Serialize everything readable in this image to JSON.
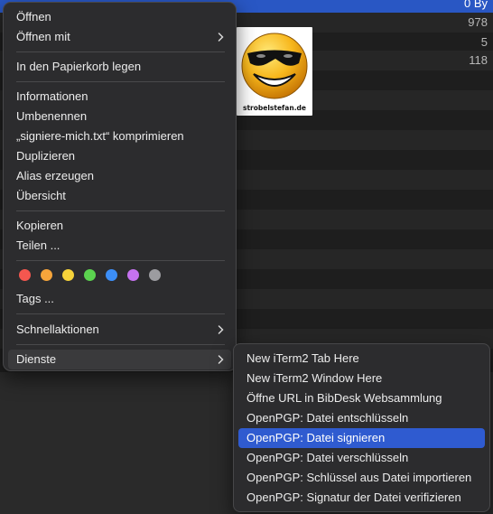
{
  "background": {
    "sizes": [
      "0 By",
      "978",
      "5",
      "118"
    ]
  },
  "preview": {
    "watermark": "strobelstefan.de"
  },
  "context_menu": {
    "items": [
      {
        "label": "Öffnen"
      },
      {
        "label": "Öffnen mit",
        "submenu": true
      },
      {
        "label": "In den Papierkorb legen"
      },
      {
        "label": "Informationen"
      },
      {
        "label": "Umbenennen"
      },
      {
        "label": "„signiere-mich.txt“ komprimieren"
      },
      {
        "label": "Duplizieren"
      },
      {
        "label": "Alias erzeugen"
      },
      {
        "label": "Übersicht"
      },
      {
        "label": "Kopieren"
      },
      {
        "label": "Teilen ..."
      },
      {
        "label": "Tags ..."
      },
      {
        "label": "Schnellaktionen",
        "submenu": true
      },
      {
        "label": "Dienste",
        "submenu": true,
        "highlighted": true
      }
    ],
    "tag_colors": [
      "#f4574f",
      "#f7a53b",
      "#f5d23a",
      "#5bd34f",
      "#3c8ef7",
      "#c672f0",
      "#9c9ca0"
    ]
  },
  "services_submenu": {
    "items": [
      {
        "label": "New iTerm2 Tab Here"
      },
      {
        "label": "New iTerm2 Window Here"
      },
      {
        "label": "Öffne URL in BibDesk Websammlung"
      },
      {
        "label": "OpenPGP: Datei entschlüsseln"
      },
      {
        "label": "OpenPGP: Datei signieren",
        "active": true
      },
      {
        "label": "OpenPGP: Datei verschlüsseln"
      },
      {
        "label": "OpenPGP: Schlüssel aus Datei importieren"
      },
      {
        "label": "OpenPGP: Signatur der Datei verifizieren"
      }
    ],
    "accent_color": "#2f5bd0"
  }
}
